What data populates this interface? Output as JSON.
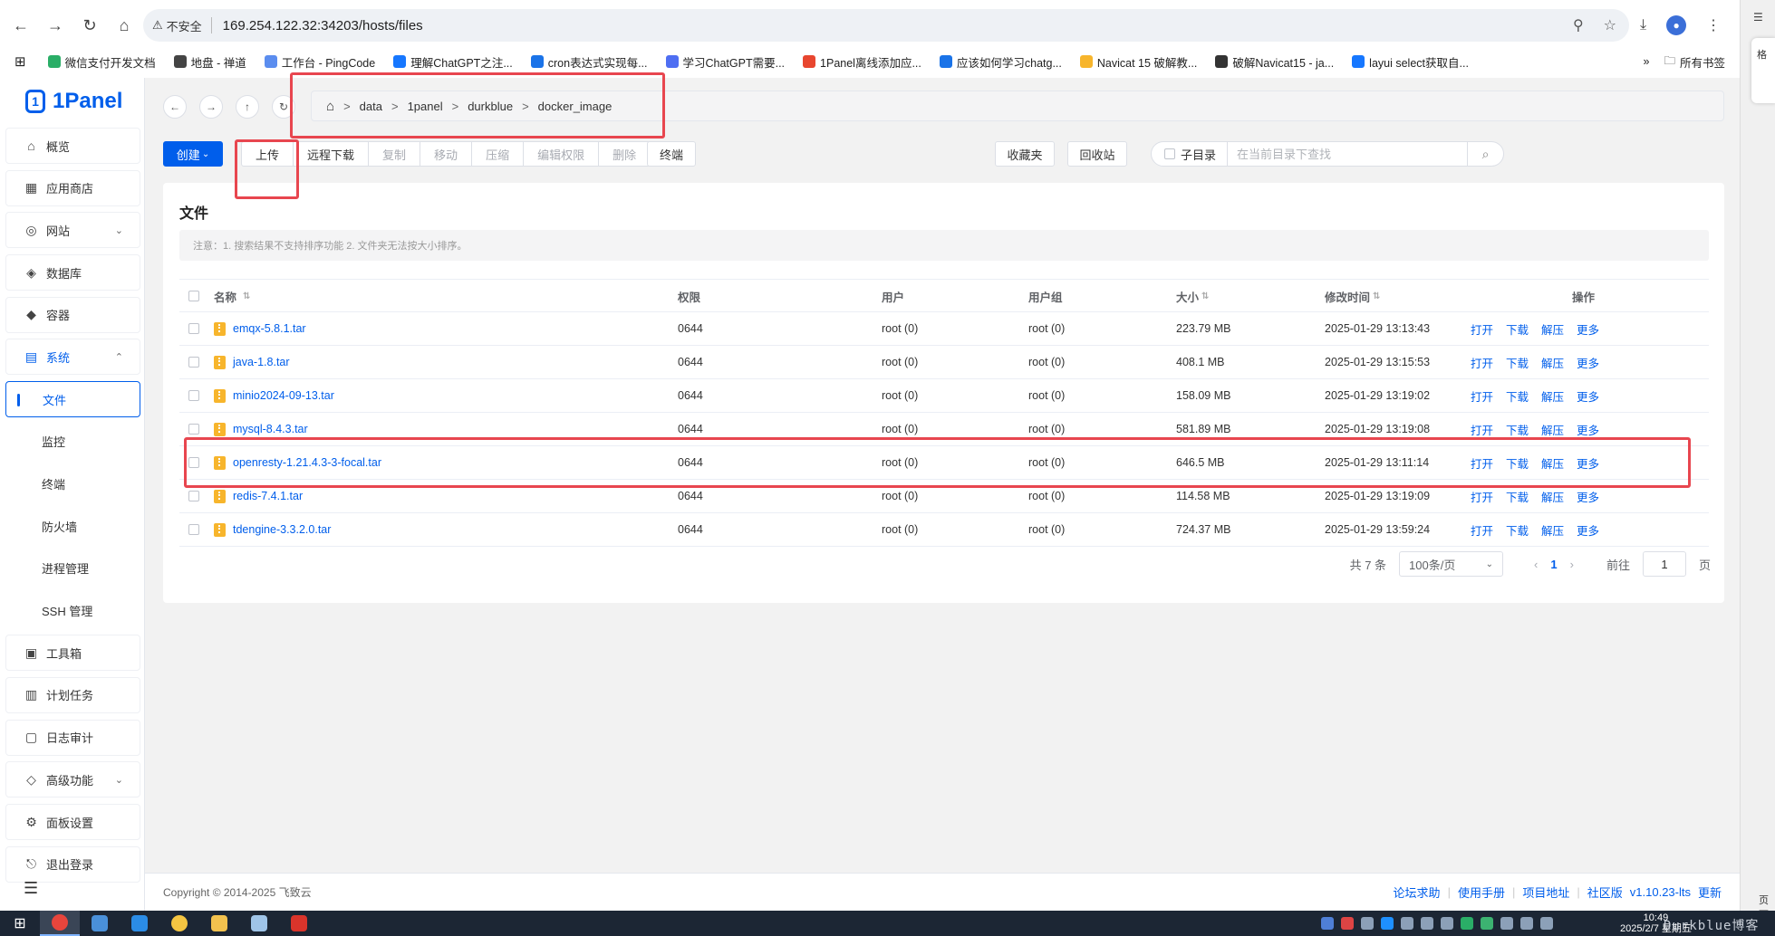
{
  "browser": {
    "insecure_label": "不安全",
    "url": "169.254.122.32:34203/hosts/files",
    "bookmarks": [
      {
        "label": "微信支付开发文档",
        "color": "#2aae67"
      },
      {
        "label": "地盘 - 禅道",
        "color": "#444444"
      },
      {
        "label": "工作台 - PingCode",
        "color": "#5b8def"
      },
      {
        "label": "理解ChatGPT之注...",
        "color": "#1677ff"
      },
      {
        "label": "cron表达式实现每...",
        "color": "#1a73e8"
      },
      {
        "label": "学习ChatGPT需要...",
        "color": "#4e6ef2"
      },
      {
        "label": "1Panel离线添加应...",
        "color": "#e8462f"
      },
      {
        "label": "应该如何学习chatg...",
        "color": "#1a73e8"
      },
      {
        "label": "Navicat 15 破解教...",
        "color": "#f7b52c"
      },
      {
        "label": "破解Navicat15 - ja...",
        "color": "#333333"
      },
      {
        "label": "layui select获取自...",
        "color": "#1677ff"
      }
    ],
    "all_bookmarks_label": "所有书签"
  },
  "sidebar": {
    "logo_text": "1Panel",
    "items": [
      {
        "label": "概览",
        "icon": "home-icon",
        "glyph": "⌂"
      },
      {
        "label": "应用商店",
        "icon": "grid-icon",
        "glyph": "▦"
      },
      {
        "label": "网站",
        "icon": "globe-icon",
        "glyph": "◎",
        "caret": "⌄"
      },
      {
        "label": "数据库",
        "icon": "layers-icon",
        "glyph": "◈"
      },
      {
        "label": "容器",
        "icon": "docker-icon",
        "glyph": "◆"
      },
      {
        "label": "系统",
        "icon": "system-icon",
        "glyph": "▤",
        "caret": "⌃"
      }
    ],
    "sub_items": [
      "文件",
      "监控",
      "终端",
      "防火墙",
      "进程管理",
      "SSH 管理"
    ],
    "bottom_items": [
      {
        "label": "工具箱",
        "icon": "toolbox-icon",
        "glyph": "▣"
      },
      {
        "label": "计划任务",
        "icon": "calendar-icon",
        "glyph": "▥"
      },
      {
        "label": "日志审计",
        "icon": "log-icon",
        "glyph": "▢"
      },
      {
        "label": "高级功能",
        "icon": "diamond-icon",
        "glyph": "◇",
        "caret": "⌄"
      },
      {
        "label": "面板设置",
        "icon": "gear-icon",
        "glyph": "⚙"
      },
      {
        "label": "退出登录",
        "icon": "logout-icon",
        "glyph": "⎋"
      }
    ]
  },
  "breadcrumb": [
    "data",
    "1panel",
    "durkblue",
    "docker_image"
  ],
  "toolbar": {
    "create": "创建",
    "group": [
      {
        "label": "上传",
        "disabled": false
      },
      {
        "label": "远程下载",
        "disabled": false
      },
      {
        "label": "复制",
        "disabled": true
      },
      {
        "label": "移动",
        "disabled": true
      },
      {
        "label": "压缩",
        "disabled": true
      },
      {
        "label": "编辑权限",
        "disabled": true
      },
      {
        "label": "删除",
        "disabled": true
      }
    ],
    "terminal": "终端",
    "favorites": "收藏夹",
    "recycle": "回收站",
    "subdir_label": "子目录",
    "search_placeholder": "在当前目录下查找"
  },
  "card": {
    "title": "文件",
    "notice": "注意：1. 搜索结果不支持排序功能 2. 文件夹无法按大小排序。"
  },
  "table": {
    "headers": {
      "name": "名称",
      "perm": "权限",
      "user": "用户",
      "group": "用户组",
      "size": "大小",
      "mtime": "修改时间",
      "ops": "操作"
    },
    "op_labels": [
      "打开",
      "下载",
      "解压",
      "更多"
    ],
    "rows": [
      {
        "name": "emqx-5.8.1.tar",
        "perm": "0644",
        "user": "root (0)",
        "group": "root (0)",
        "size": "223.79 MB",
        "mtime": "2025-01-29 13:13:43"
      },
      {
        "name": "java-1.8.tar",
        "perm": "0644",
        "user": "root (0)",
        "group": "root (0)",
        "size": "408.1 MB",
        "mtime": "2025-01-29 13:15:53"
      },
      {
        "name": "minio2024-09-13.tar",
        "perm": "0644",
        "user": "root (0)",
        "group": "root (0)",
        "size": "158.09 MB",
        "mtime": "2025-01-29 13:19:02"
      },
      {
        "name": "mysql-8.4.3.tar",
        "perm": "0644",
        "user": "root (0)",
        "group": "root (0)",
        "size": "581.89 MB",
        "mtime": "2025-01-29 13:19:08"
      },
      {
        "name": "openresty-1.21.4.3-3-focal.tar",
        "perm": "0644",
        "user": "root (0)",
        "group": "root (0)",
        "size": "646.5 MB",
        "mtime": "2025-01-29 13:11:14"
      },
      {
        "name": "redis-7.4.1.tar",
        "perm": "0644",
        "user": "root (0)",
        "group": "root (0)",
        "size": "114.58 MB",
        "mtime": "2025-01-29 13:19:09"
      },
      {
        "name": "tdengine-3.3.2.0.tar",
        "perm": "0644",
        "user": "root (0)",
        "group": "root (0)",
        "size": "724.37 MB",
        "mtime": "2025-01-29 13:59:24"
      }
    ]
  },
  "pager": {
    "total": "共 7 条",
    "page_size": "100条/页",
    "current": "1",
    "goto_label": "前往",
    "goto_value": "1",
    "page_suffix": "页"
  },
  "footer": {
    "copyright": "Copyright © 2014-2025 飞致云",
    "links": [
      "论坛求助",
      "使用手册",
      "项目地址",
      "社区版"
    ],
    "version": "v1.10.23-lts",
    "update": "更新"
  },
  "taskbar": {
    "time": "10:49",
    "date": "2025/2/7 星期五",
    "watermark": "Durkblue博客"
  },
  "right_sliver": {
    "panel_text": "格",
    "bottom_text": "页面"
  },
  "colors": {
    "accent": "#005eeb",
    "annotation": "#e8464f",
    "file_icon": "#f7b52c"
  }
}
